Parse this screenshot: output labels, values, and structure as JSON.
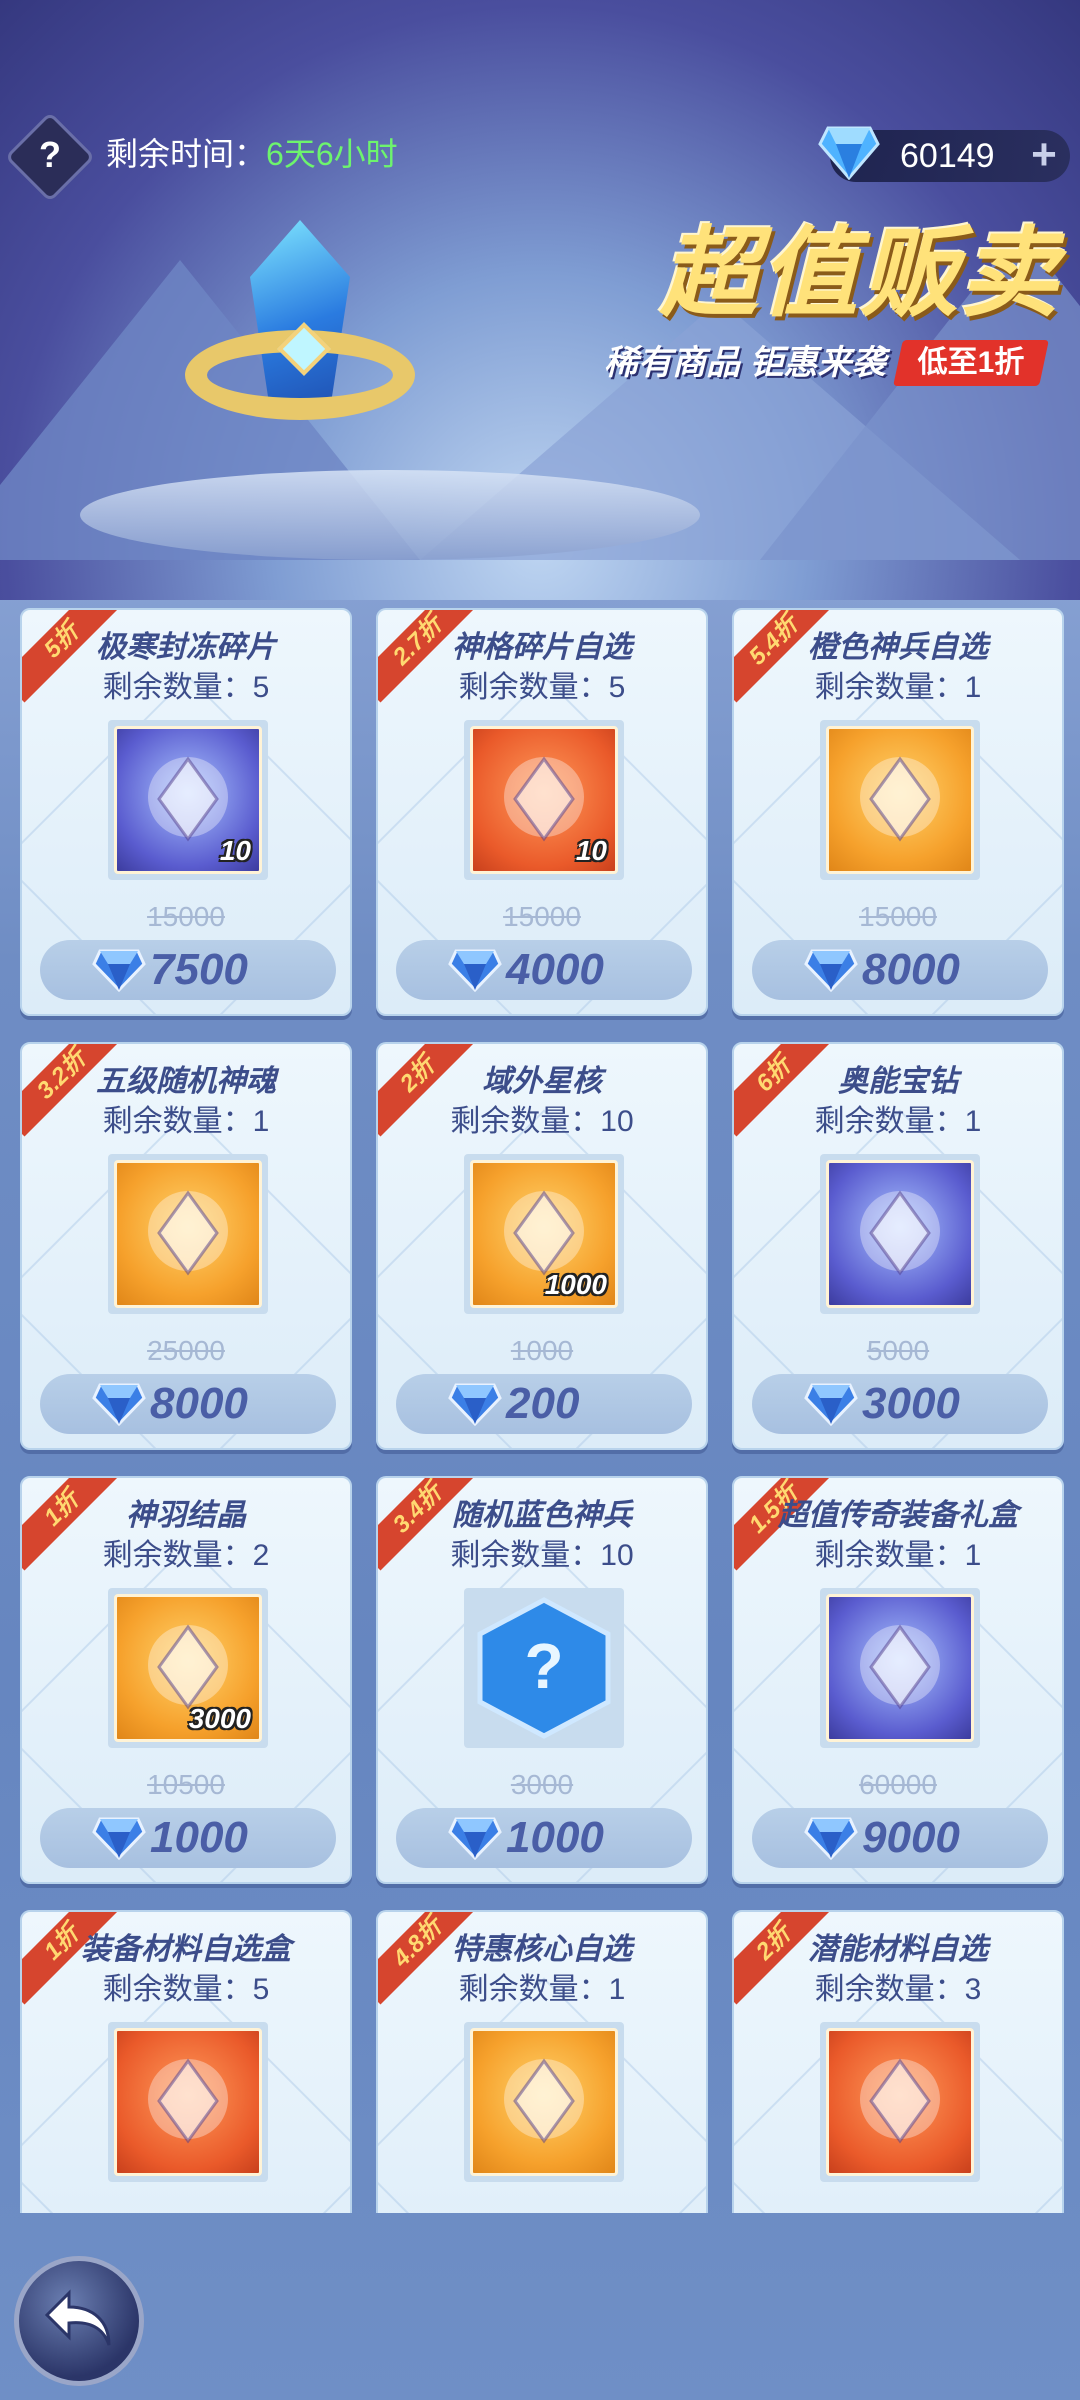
{
  "header": {
    "time_label": "剩余时间：",
    "time_value": "6天6小时",
    "currency_value": "60149",
    "promo_title": "超值贩卖",
    "promo_subtitle": "稀有商品 钜惠来袭",
    "promo_tag": "低至1折"
  },
  "items": [
    {
      "name": "极寒封冻碎片",
      "remaining": "剩余数量：5",
      "discount": "5折",
      "original_price": "15000",
      "price": "7500",
      "qty": "10",
      "icon": "hero-portrait-icon"
    },
    {
      "name": "神格碎片自选",
      "remaining": "剩余数量：5",
      "discount": "2.7折",
      "original_price": "15000",
      "price": "4000",
      "qty": "10",
      "icon": "godhead-cube-icon"
    },
    {
      "name": "橙色神兵自选",
      "remaining": "剩余数量：1",
      "discount": "5.4折",
      "original_price": "15000",
      "price": "8000",
      "qty": "",
      "icon": "orange-weapon-icon"
    },
    {
      "name": "五级随机神魂",
      "remaining": "剩余数量：1",
      "discount": "3.2折",
      "original_price": "25000",
      "price": "8000",
      "qty": "",
      "icon": "random-soul-icon"
    },
    {
      "name": "域外星核",
      "remaining": "剩余数量：10",
      "discount": "2折",
      "original_price": "1000",
      "price": "200",
      "qty": "1000",
      "icon": "star-core-ore-icon"
    },
    {
      "name": "奥能宝钻",
      "remaining": "剩余数量：1",
      "discount": "6折",
      "original_price": "5000",
      "price": "3000",
      "qty": "",
      "icon": "arcane-diamond-icon"
    },
    {
      "name": "神羽结晶",
      "remaining": "剩余数量：2",
      "discount": "1折",
      "original_price": "10500",
      "price": "1000",
      "qty": "3000",
      "icon": "phoenix-feather-icon"
    },
    {
      "name": "随机蓝色神兵",
      "remaining": "剩余数量：10",
      "discount": "3.4折",
      "original_price": "3000",
      "price": "1000",
      "qty": "",
      "icon": "random-blue-weapon-icon"
    },
    {
      "name": "超值传奇装备礼盒",
      "remaining": "剩余数量：1",
      "discount": "1.5折",
      "original_price": "60000",
      "price": "9000",
      "qty": "",
      "icon": "legendary-armor-box-icon"
    },
    {
      "name": "装备材料自选盒",
      "remaining": "剩余数量：5",
      "discount": "1折",
      "original_price": "",
      "price": "",
      "qty": "",
      "icon": "equipment-material-box-icon"
    },
    {
      "name": "特惠核心自选",
      "remaining": "剩余数量：1",
      "discount": "4.8折",
      "original_price": "",
      "price": "",
      "qty": "",
      "icon": "core-card-icon"
    },
    {
      "name": "潜能材料自选",
      "remaining": "剩余数量：3",
      "discount": "2折",
      "original_price": "",
      "price": "",
      "qty": "",
      "icon": "treasure-chest-icon"
    }
  ],
  "colors": {
    "accent_green": "#6df46d",
    "price_text": "#4a5ea6",
    "ribbon": "#d6452e",
    "promo_tag": "#e2322a"
  }
}
